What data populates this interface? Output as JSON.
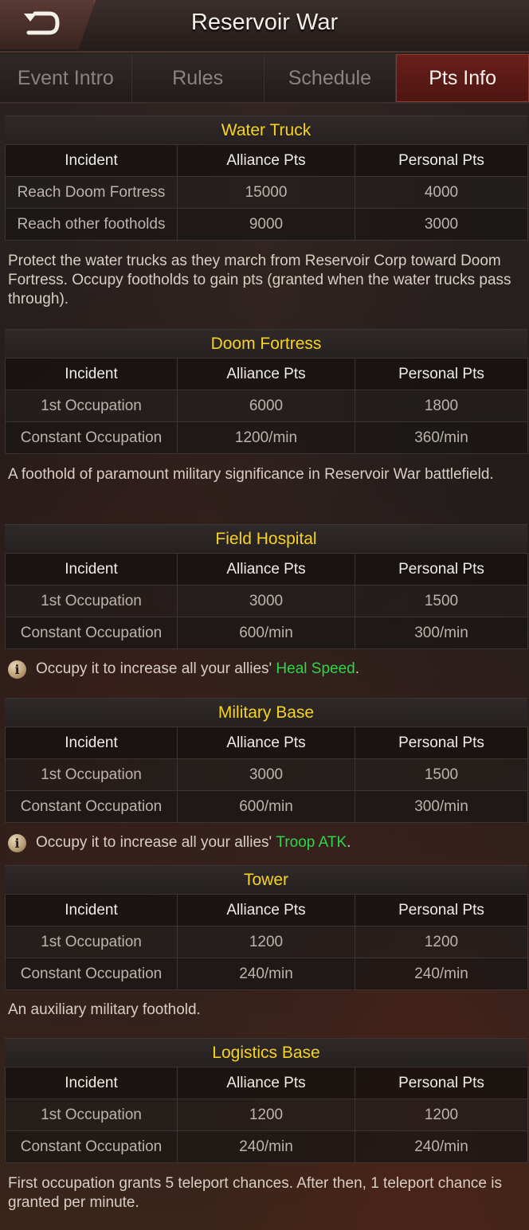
{
  "header": {
    "title": "Reservoir War"
  },
  "tabs": [
    {
      "label": "Event Intro",
      "active": false
    },
    {
      "label": "Rules",
      "active": false
    },
    {
      "label": "Schedule",
      "active": false
    },
    {
      "label": "Pts Info",
      "active": true
    }
  ],
  "columns": [
    "Incident",
    "Alliance Pts",
    "Personal Pts"
  ],
  "sections": [
    {
      "title": "Water Truck",
      "rows": [
        [
          "Reach Doom Fortress",
          "15000",
          "4000"
        ],
        [
          "Reach other footholds",
          "9000",
          "3000"
        ]
      ],
      "desc": "Protect the water trucks as they march from Reservoir Corp toward Doom Fortress. Occupy footholds to gain pts (granted when the water trucks pass through)."
    },
    {
      "title": "Doom Fortress",
      "rows": [
        [
          "1st Occupation",
          "6000",
          "1800"
        ],
        [
          "Constant Occupation",
          "1200/min",
          "360/min"
        ]
      ],
      "desc": "A foothold of paramount military significance in Reservoir War battlefield."
    },
    {
      "title": "Field Hospital",
      "rows": [
        [
          "1st Occupation",
          "3000",
          "1500"
        ],
        [
          "Constant Occupation",
          "600/min",
          "300/min"
        ]
      ],
      "note": {
        "text": "Occupy it to increase all your allies' ",
        "highlight": "Heal Speed",
        "suffix": "."
      }
    },
    {
      "title": "Military Base",
      "rows": [
        [
          "1st Occupation",
          "3000",
          "1500"
        ],
        [
          "Constant Occupation",
          "600/min",
          "300/min"
        ]
      ],
      "note": {
        "text": "Occupy it to increase all your allies' ",
        "highlight": "Troop ATK",
        "suffix": "."
      }
    },
    {
      "title": "Tower",
      "rows": [
        [
          "1st Occupation",
          "1200",
          "1200"
        ],
        [
          "Constant Occupation",
          "240/min",
          "240/min"
        ]
      ],
      "desc": "An auxiliary military foothold."
    },
    {
      "title": "Logistics Base",
      "rows": [
        [
          "1st Occupation",
          "1200",
          "1200"
        ],
        [
          "Constant Occupation",
          "240/min",
          "240/min"
        ]
      ],
      "desc": "First occupation grants 5 teleport chances. After then, 1 teleport chance is granted per minute."
    }
  ],
  "colors": {
    "title_yellow": "#f6d320",
    "highlight_green": "#2fd64a",
    "active_tab": "#6a1f1a"
  },
  "icons": {
    "back": "back-arrow-icon",
    "info": "info-icon"
  }
}
